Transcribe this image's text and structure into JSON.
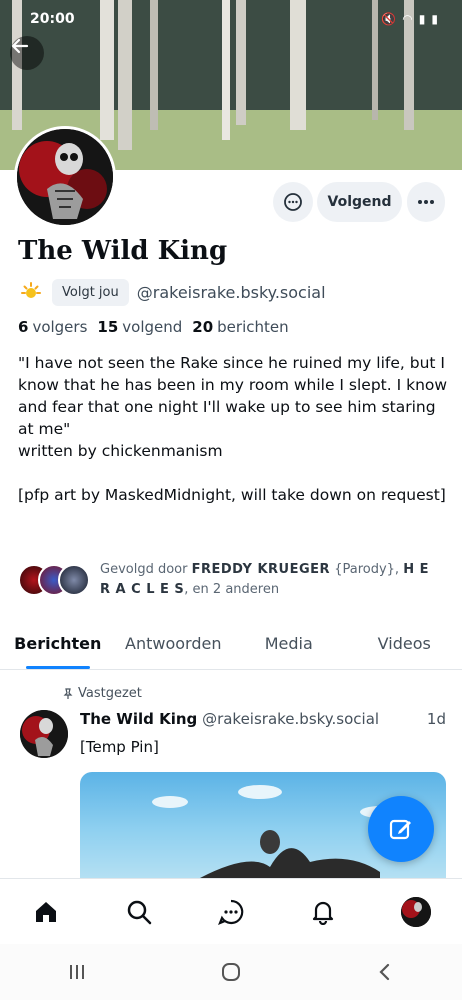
{
  "status_bar": {
    "time": "20:00"
  },
  "profile": {
    "display_name": "The Wild King",
    "follows_you_badge": "Volgt jou",
    "handle": "@rakeisrake.bsky.social",
    "stats": {
      "followers_count": "6",
      "followers_label": "volgers",
      "following_count": "15",
      "following_label": "volgend",
      "posts_count": "20",
      "posts_label": "berichten"
    },
    "bio": "\"I have not seen the Rake since he ruined my life, but I know that he has been in my room while I slept. I know and fear that one night I'll wake up to see him staring at me\"\nwritten by chickenmanism\n\n[pfp art by MaskedMidnight, will take down on request]",
    "followed_by": {
      "prefix": "Gevolgd door",
      "name1": "FREDDY KRUEGER",
      "name1_suffix": "{Parody}, ",
      "name2": "H E R A C L E S",
      "suffix": ", en 2 anderen"
    }
  },
  "actions": {
    "follow_label": "Volgend"
  },
  "tabs": [
    {
      "label": "Berichten",
      "active": true
    },
    {
      "label": "Antwoorden",
      "active": false
    },
    {
      "label": "Media",
      "active": false
    },
    {
      "label": "Videos",
      "active": false
    }
  ],
  "post": {
    "pinned_label": "Vastgezet",
    "author_name": "The Wild King",
    "author_handle": "@rakeisrake.bsky.social",
    "time": "1d",
    "text": "[Temp Pin]"
  },
  "colors": {
    "accent": "#1083fe",
    "chip_bg": "#eef1f5"
  },
  "icons": {
    "back": "arrow-left-icon",
    "chat": "chat-bubble-icon",
    "more": "ellipsis-icon",
    "compose": "pencil-square-icon",
    "home": "home-icon",
    "search": "search-icon",
    "messages": "messages-icon",
    "notifications": "bell-icon"
  }
}
